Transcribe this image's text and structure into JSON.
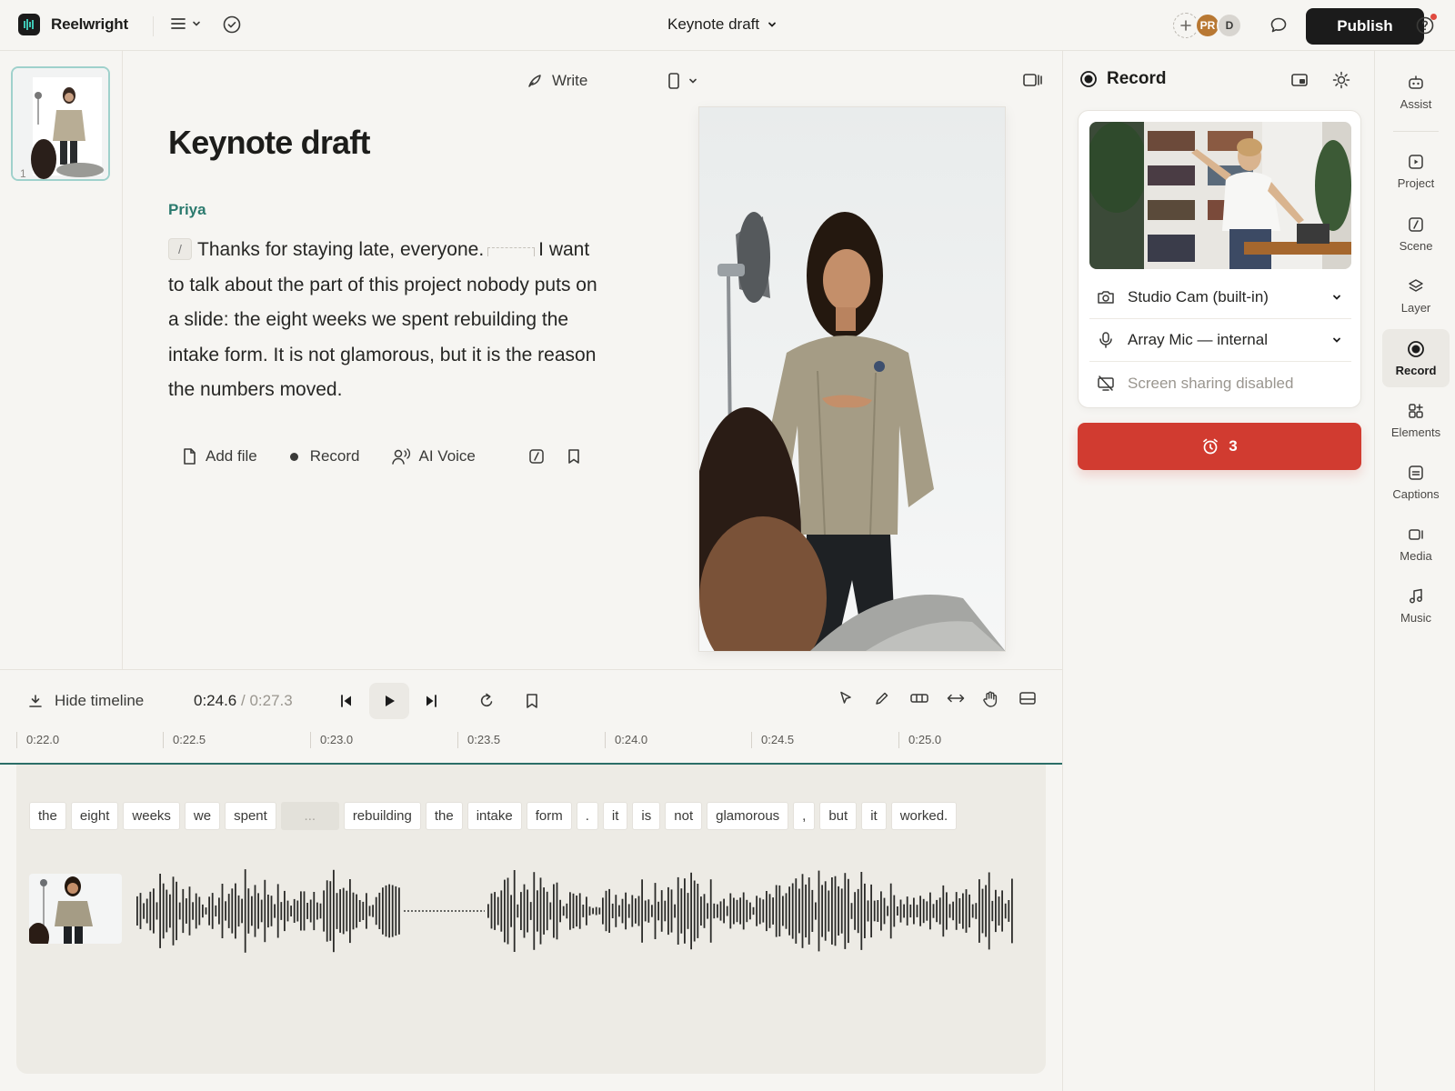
{
  "app": {
    "name": "Reelwright"
  },
  "document": {
    "title": "Keynote draft"
  },
  "topbar": {
    "avatars": [
      "PR",
      "D"
    ],
    "publish_label": "Publish"
  },
  "slides": [
    {
      "number": "1"
    }
  ],
  "editor": {
    "write_label": "Write",
    "heading": "Keynote draft",
    "speaker": "Priya",
    "slash": "/",
    "script_part1": "Thanks for staying late, everyone.",
    "script_part2": "I want to talk about the part of this project nobody puts on a slide: the eight weeks we spent rebuilding the intake form. It is not glamorous, but it is the reason the numbers moved.",
    "actions": {
      "add_file": "Add file",
      "record": "Record",
      "ai_voice": "AI Voice"
    }
  },
  "record_panel": {
    "title": "Record",
    "camera": "Studio Cam (built-in)",
    "mic": "Array Mic — internal",
    "screen": "Screen sharing disabled",
    "countdown": "3"
  },
  "rail": [
    {
      "label": "Assist",
      "icon": "robot-icon"
    },
    {
      "label": "Project",
      "icon": "play-square-icon"
    },
    {
      "label": "Scene",
      "icon": "scene-icon"
    },
    {
      "label": "Layer",
      "icon": "layers-icon"
    },
    {
      "label": "Record",
      "icon": "record-icon",
      "active": true
    },
    {
      "label": "Elements",
      "icon": "elements-icon"
    },
    {
      "label": "Captions",
      "icon": "captions-icon"
    },
    {
      "label": "Media",
      "icon": "media-icon"
    },
    {
      "label": "Music",
      "icon": "music-icon"
    }
  ],
  "timeline": {
    "hide_label": "Hide timeline",
    "current_time": "0:24.6",
    "separator": "/",
    "total_time": "0:27.3",
    "ticks": [
      "0:22.0",
      "0:22.5",
      "0:23.0",
      "0:23.5",
      "0:24.0",
      "0:24.5",
      "0:25.0"
    ],
    "words": [
      "the",
      "eight",
      "weeks",
      "we",
      "spent",
      "...",
      "rebuilding",
      "the",
      "intake",
      "form",
      ".",
      "it",
      "is",
      "not",
      "glamorous",
      ",",
      "but",
      "it",
      "worked."
    ]
  },
  "colors": {
    "accent": "#2b7a6e",
    "record": "#d13b30",
    "publish": "#1b1b1b"
  }
}
